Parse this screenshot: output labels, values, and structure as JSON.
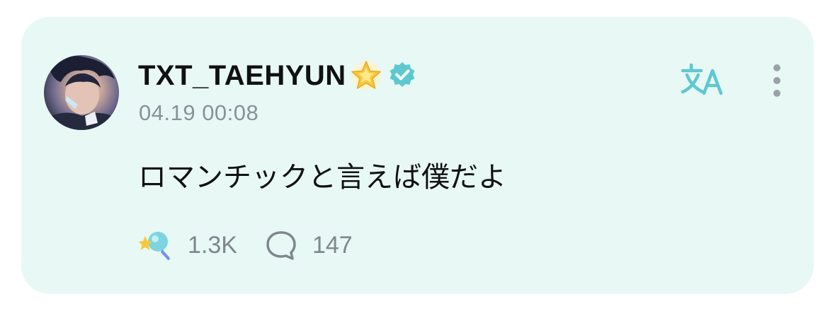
{
  "post": {
    "username": "TXT_TAEHYUN",
    "timestamp": "04.19 00:08",
    "text": "ロマンチックと言えば僕だよ",
    "reactions_count": "1.3K",
    "comments_count": "147"
  },
  "icons": {
    "star": "glowing-star-icon",
    "verified": "verified-badge-icon",
    "translate": "translate-icon",
    "more": "more-vertical-icon",
    "reaction": "reaction-lightstick-icon",
    "comment": "comment-bubble-icon"
  },
  "colors": {
    "card_background": "#e8f8f5",
    "accent": "#5ec8cf",
    "text_primary": "#111111",
    "text_secondary": "#8a9197"
  }
}
